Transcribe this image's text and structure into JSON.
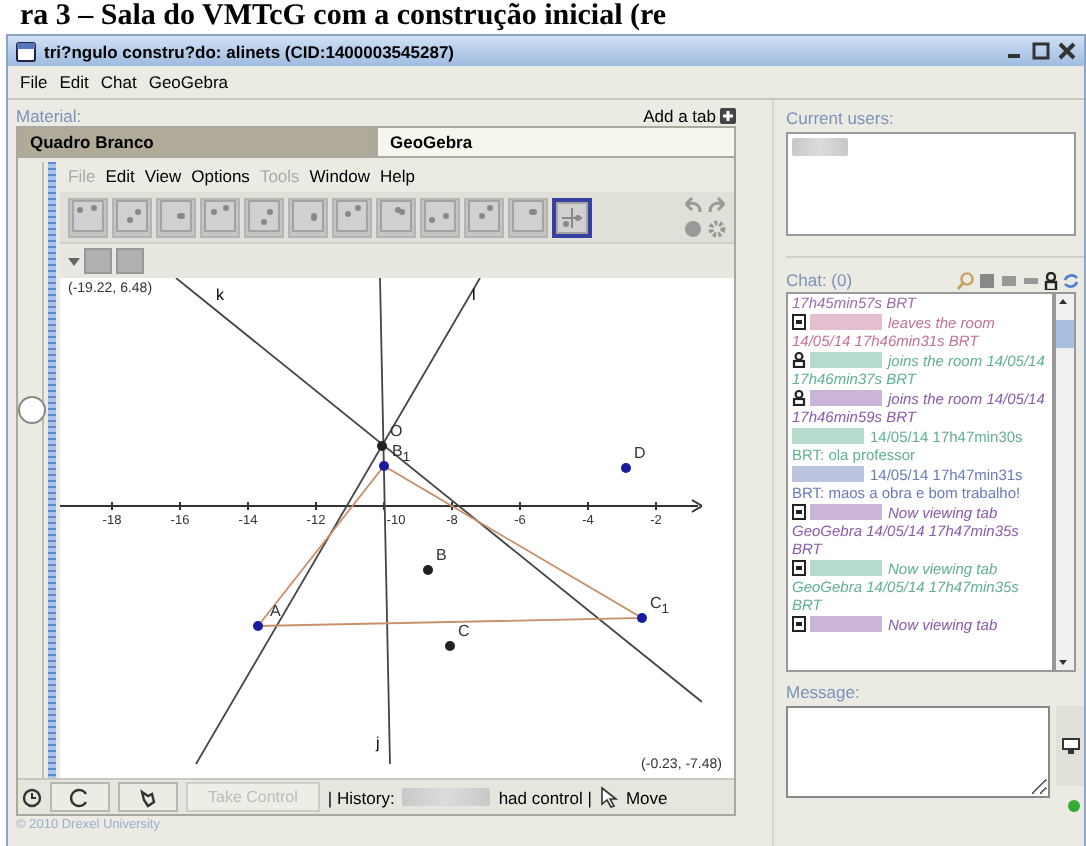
{
  "caption": "ra 3 – Sala do VMTcG com a construção inicial (re",
  "window": {
    "title": "tri?ngulo constru?do: alinets (CID:1400003545287)"
  },
  "menu": [
    "File",
    "Edit",
    "Chat",
    "GeoGebra"
  ],
  "material": {
    "label": "Material:",
    "add_tab": "Add a tab",
    "tabs": [
      {
        "label": "Quadro Branco",
        "selected": false
      },
      {
        "label": "GeoGebra",
        "selected": true
      }
    ]
  },
  "zoom_slider": {
    "level": 0.6
  },
  "geogebra": {
    "menu": [
      {
        "label": "File",
        "disabled": true
      },
      {
        "label": "Edit",
        "disabled": false
      },
      {
        "label": "View",
        "disabled": false
      },
      {
        "label": "Options",
        "disabled": false
      },
      {
        "label": "Tools",
        "disabled": true
      },
      {
        "label": "Window",
        "disabled": false
      },
      {
        "label": "Help",
        "disabled": false
      }
    ],
    "tools": [
      {
        "selected": false
      },
      {
        "selected": false
      },
      {
        "selected": false
      },
      {
        "selected": false
      },
      {
        "selected": false
      },
      {
        "selected": false
      },
      {
        "selected": false
      },
      {
        "selected": false
      },
      {
        "selected": false
      },
      {
        "selected": false
      },
      {
        "selected": false
      },
      {
        "selected": true
      }
    ],
    "corner_top": "(-19.22, 6.48)",
    "corner_bottom": "(-0.23, -7.48)",
    "xticks": [
      "-18",
      "-16",
      "-14",
      "-12",
      "-10",
      "-8",
      "-6",
      "-4",
      "-2"
    ],
    "lines": [
      {
        "label": "k"
      },
      {
        "label": "l"
      },
      {
        "label": "j"
      }
    ],
    "points": [
      {
        "label": "O",
        "color": "#222222"
      },
      {
        "label": "B$_{1}$",
        "color": "#1a1aa0"
      },
      {
        "label": "D",
        "color": "#1a1aa0"
      },
      {
        "label": "B",
        "color": "#222222"
      },
      {
        "label": "A",
        "color": "#1a1aa0"
      },
      {
        "label": "C$_{1}$",
        "color": "#1a1aa0"
      },
      {
        "label": "C",
        "color": "#222222"
      }
    ]
  },
  "control_bar": {
    "take_control": "Take Control",
    "history": "| History:",
    "had_control": "had control |",
    "mode": "Move"
  },
  "footer": "© 2010 Drexel University",
  "users": {
    "label": "Current users:"
  },
  "chat": {
    "label": "Chat: (0)",
    "messages": [
      {
        "kind": "cont",
        "text": "17h45min57s BRT",
        "color": "#9a6ab0"
      },
      {
        "kind": "leave",
        "text": "leaves the room",
        "time": "14/05/14 17h46min31s BRT",
        "color": "#c0709a"
      },
      {
        "kind": "join",
        "text": "joins the room",
        "time": "14/05/14 17h46min37s BRT",
        "color": "#60b090"
      },
      {
        "kind": "join",
        "text": "joins the room",
        "time": "14/05/14 17h46min59s BRT",
        "color": "#8a5aa8"
      },
      {
        "kind": "chat",
        "time": "14/05/14 17h47min30s BRT:",
        "text": "ola professor",
        "color": "#60b090"
      },
      {
        "kind": "chat",
        "time": "14/05/14 17h47min31s BRT:",
        "text": "maos a obra e bom trabalho!",
        "color": "#6a7ab8"
      },
      {
        "kind": "view",
        "text": "Now viewing tab GeoGebra 14/05/14 17h47min35s BRT",
        "color": "#8a5aa8"
      },
      {
        "kind": "view",
        "text": "Now viewing tab GeoGebra 14/05/14 17h47min35s BRT",
        "color": "#60b090"
      },
      {
        "kind": "view",
        "text": "Now viewing tab",
        "color": "#8a5aa8"
      }
    ]
  },
  "message": {
    "label": "Message:"
  }
}
